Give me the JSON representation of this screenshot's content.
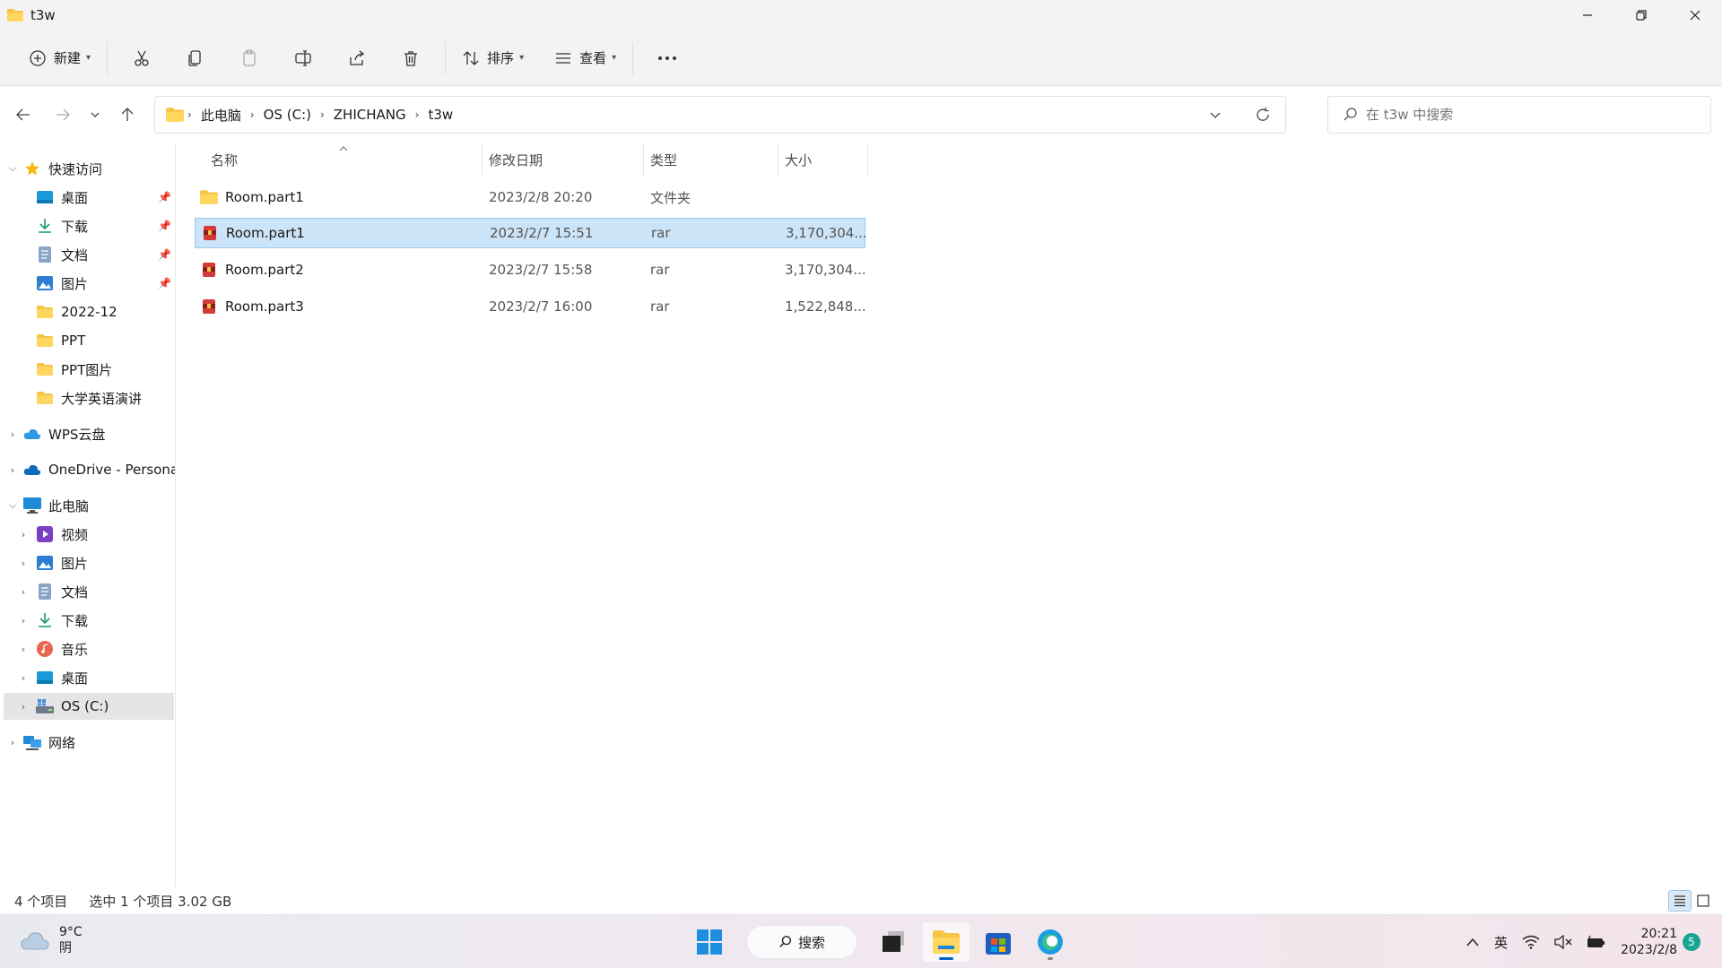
{
  "window": {
    "title": "t3w",
    "controls": {
      "minimize": "minimize-icon",
      "restore": "restore-icon",
      "close": "close-icon"
    }
  },
  "toolbar": {
    "new_label": "新建",
    "sort_label": "排序",
    "view_label": "查看",
    "icons": [
      "plus-circle-icon",
      "cut-icon",
      "copy-icon",
      "paste-icon",
      "rename-icon",
      "share-icon",
      "delete-icon",
      "sort-icon",
      "view-icon",
      "more-icon"
    ]
  },
  "address": {
    "crumbs": [
      "此电脑",
      "OS (C:)",
      "ZHICHANG",
      "t3w"
    ]
  },
  "search": {
    "placeholder": "在 t3w 中搜索"
  },
  "sidebar": {
    "quick_access": "快速访问",
    "quick_items": [
      {
        "label": "桌面",
        "icon": "desktop-icon",
        "pinned": true
      },
      {
        "label": "下载",
        "icon": "download-icon",
        "pinned": true
      },
      {
        "label": "文档",
        "icon": "document-icon",
        "pinned": true
      },
      {
        "label": "图片",
        "icon": "pictures-icon",
        "pinned": true
      },
      {
        "label": "2022-12",
        "icon": "folder-icon",
        "pinned": false
      },
      {
        "label": "PPT",
        "icon": "folder-icon",
        "pinned": false
      },
      {
        "label": "PPT图片",
        "icon": "folder-icon",
        "pinned": false
      },
      {
        "label": "大学英语演讲",
        "icon": "folder-icon",
        "pinned": false
      }
    ],
    "wps": "WPS云盘",
    "onedrive": "OneDrive - Persona",
    "this_pc": "此电脑",
    "pc_items": [
      {
        "label": "视频",
        "icon": "video-icon"
      },
      {
        "label": "图片",
        "icon": "pictures-icon"
      },
      {
        "label": "文档",
        "icon": "document-icon"
      },
      {
        "label": "下载",
        "icon": "download-icon"
      },
      {
        "label": "音乐",
        "icon": "music-icon"
      },
      {
        "label": "桌面",
        "icon": "desktop-icon"
      },
      {
        "label": "OS (C:)",
        "icon": "drive-icon"
      }
    ],
    "network": "网络"
  },
  "columns": {
    "name": "名称",
    "date": "修改日期",
    "type": "类型",
    "size": "大小"
  },
  "files": [
    {
      "name": "Room.part1",
      "date": "2023/2/8 20:20",
      "type": "文件夹",
      "size": "",
      "icon": "folder-icon",
      "selected": false
    },
    {
      "name": "Room.part1",
      "date": "2023/2/7 15:51",
      "type": "rar",
      "size": "3,170,304...",
      "icon": "rar-icon",
      "selected": true
    },
    {
      "name": "Room.part2",
      "date": "2023/2/7 15:58",
      "type": "rar",
      "size": "3,170,304...",
      "icon": "rar-icon",
      "selected": false
    },
    {
      "name": "Room.part3",
      "date": "2023/2/7 16:00",
      "type": "rar",
      "size": "1,522,848...",
      "icon": "rar-icon",
      "selected": false
    }
  ],
  "status": {
    "count": "4 个项目",
    "selection": "选中 1 个项目  3.02 GB"
  },
  "taskbar": {
    "weather_temp": "9°C",
    "weather_desc": "阴",
    "search_label": "搜索",
    "ime": "英",
    "time": "20:21",
    "date": "2023/2/8",
    "notification_count": "5"
  }
}
